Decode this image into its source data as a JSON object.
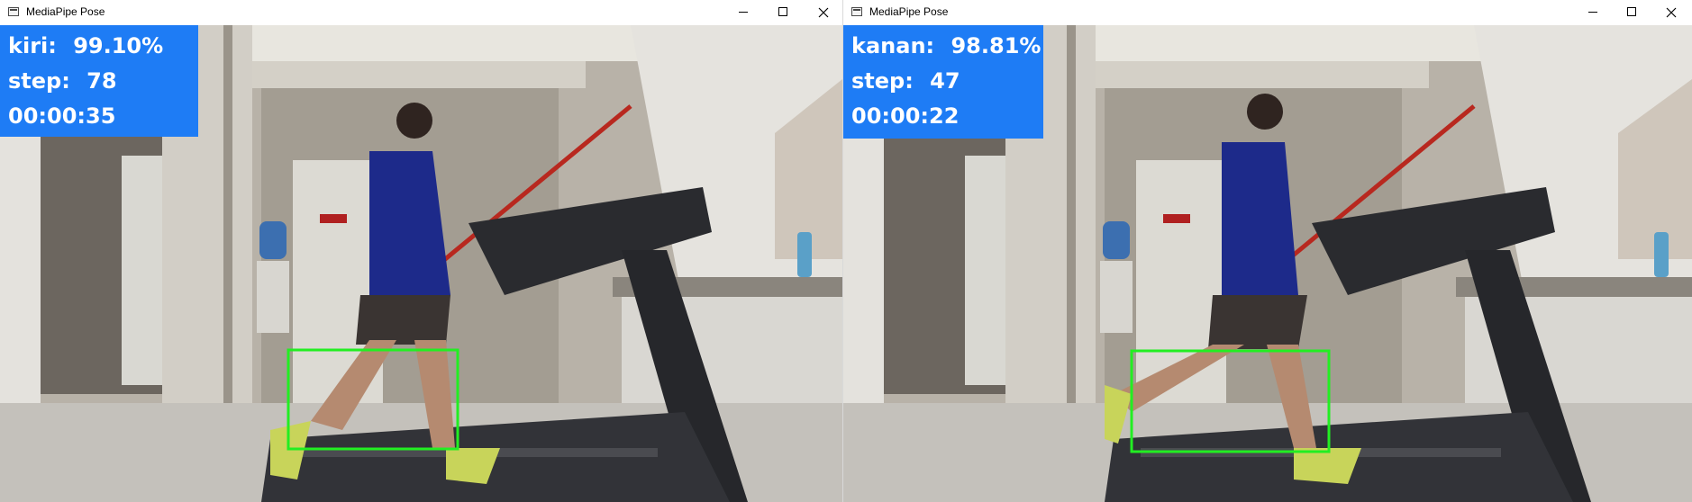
{
  "windows": [
    {
      "title": "MediaPipe Pose",
      "side_label": "kiri:",
      "confidence": "99.10%",
      "step_label": "step:",
      "step_value": "78",
      "timer": "00:00:35"
    },
    {
      "title": "MediaPipe Pose",
      "side_label": "kanan:",
      "confidence": "98.81%",
      "step_label": "step:",
      "step_value": "47",
      "timer": "00:00:22"
    }
  ],
  "colors": {
    "overlay_bg": "#1e7cf5",
    "overlay_text": "#ffffff",
    "detection_box": "#22ee22"
  },
  "icons": [
    "window-icon",
    "minimize-icon",
    "maximize-icon",
    "close-icon"
  ]
}
